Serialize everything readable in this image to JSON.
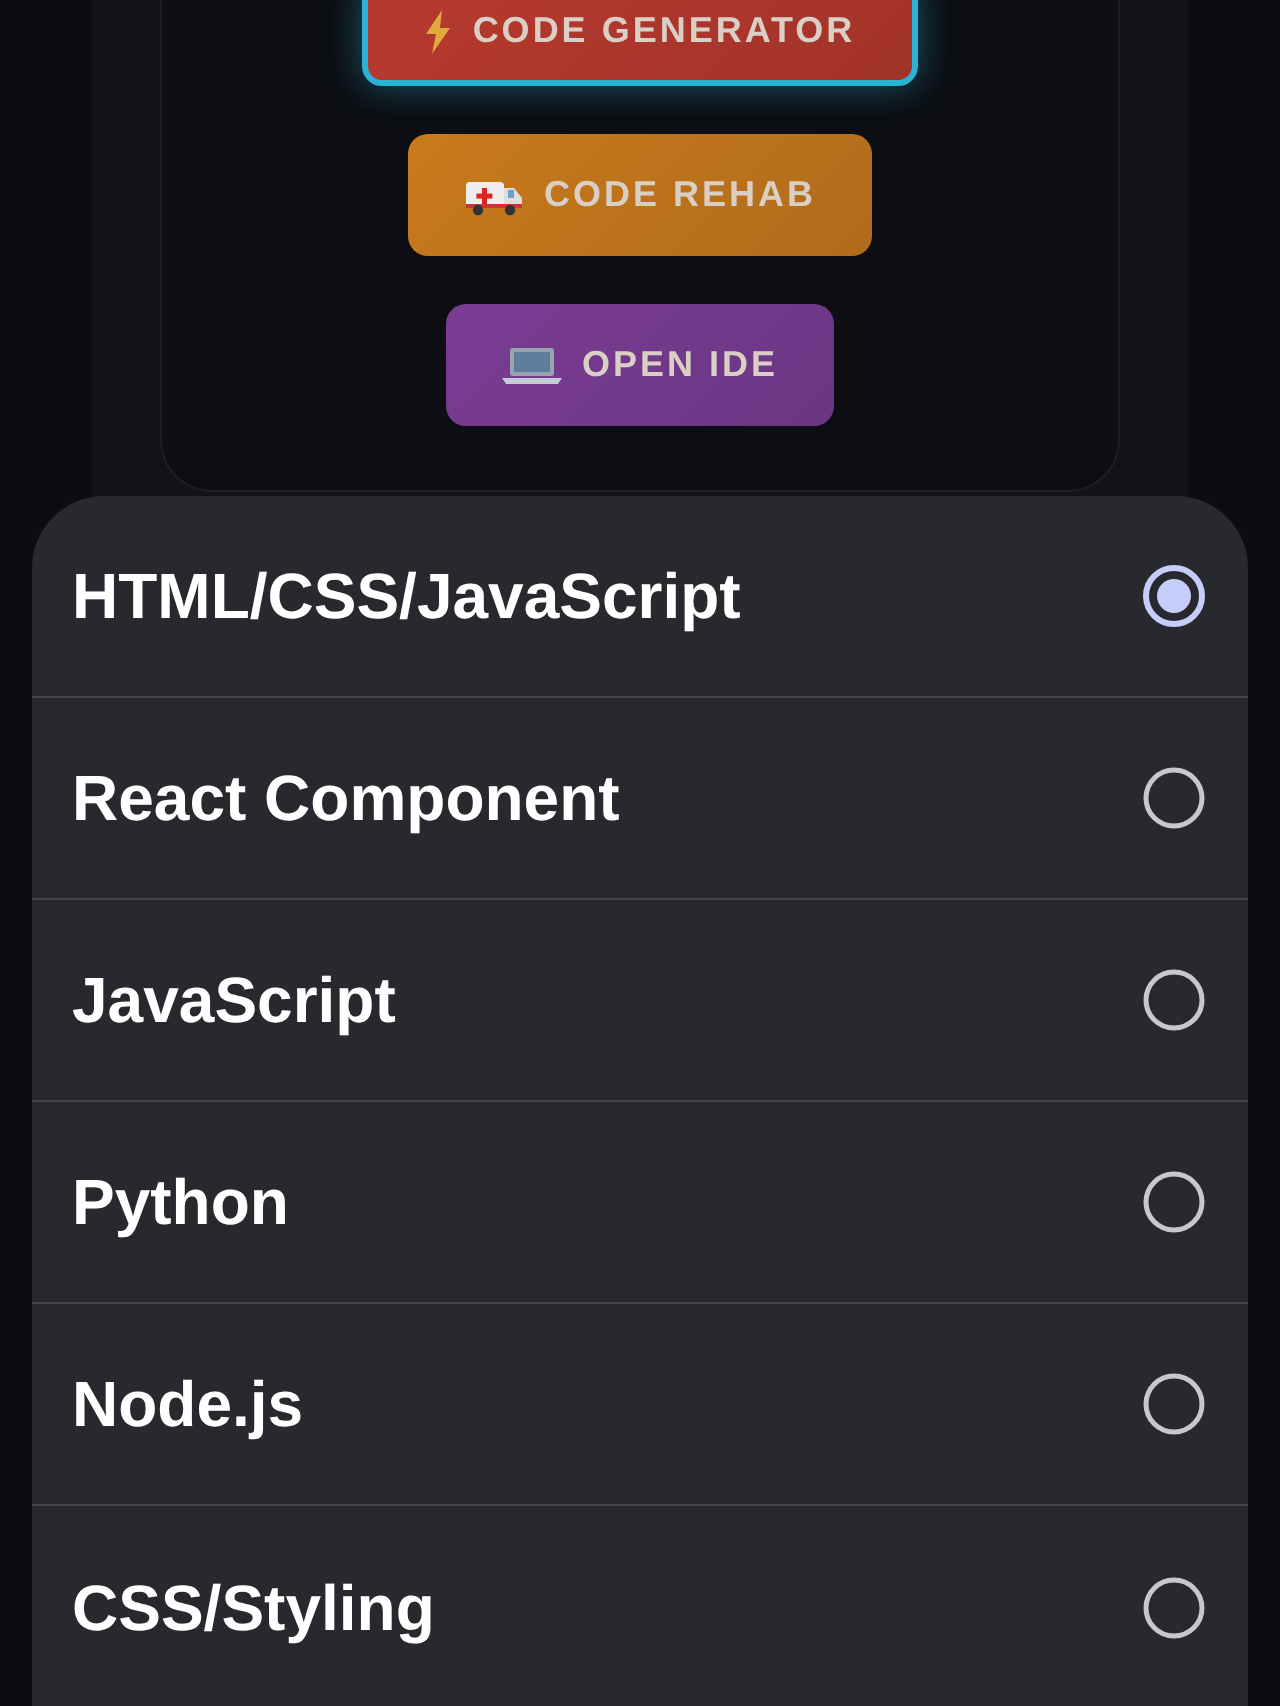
{
  "buttons": [
    {
      "label": "CODE GENERATOR",
      "kind": "bolt",
      "color": "#b8392e"
    },
    {
      "label": "CODE REHAB",
      "kind": "ambulance",
      "color": "#c97a1c"
    },
    {
      "label": "OPEN IDE",
      "kind": "laptop",
      "color": "#7a3c94"
    }
  ],
  "options": [
    {
      "label": "HTML/CSS/JavaScript",
      "selected": true
    },
    {
      "label": "React Component",
      "selected": false
    },
    {
      "label": "JavaScript",
      "selected": false
    },
    {
      "label": "Python",
      "selected": false
    },
    {
      "label": "Node.js",
      "selected": false
    },
    {
      "label": "CSS/Styling",
      "selected": false
    }
  ]
}
